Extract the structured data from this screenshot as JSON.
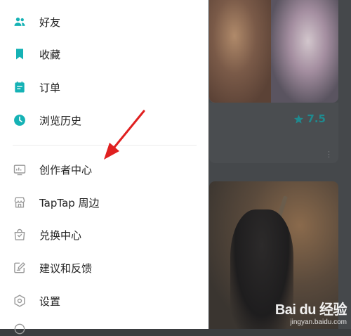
{
  "menu": {
    "items": [
      {
        "label": "好友",
        "icon": "friends-icon"
      },
      {
        "label": "收藏",
        "icon": "bookmark-icon"
      },
      {
        "label": "订单",
        "icon": "order-icon"
      },
      {
        "label": "浏览历史",
        "icon": "clock-icon"
      },
      {
        "label": "创作者中心",
        "icon": "creator-monitor-icon"
      },
      {
        "label": "TapTap 周边",
        "icon": "store-icon"
      },
      {
        "label": "兑换中心",
        "icon": "shopping-bag-icon"
      },
      {
        "label": "建议和反馈",
        "icon": "feedback-edit-icon"
      },
      {
        "label": "设置",
        "icon": "gear-icon"
      }
    ]
  },
  "background": {
    "rating": "7.5",
    "more": "⋮"
  },
  "watermark": {
    "logo": "Bai du 经验",
    "url": "jingyan.baidu.com"
  },
  "colors": {
    "accent": "#15b2b5",
    "icon_gray": "#9a9a9a",
    "arrow": "#e02020"
  }
}
